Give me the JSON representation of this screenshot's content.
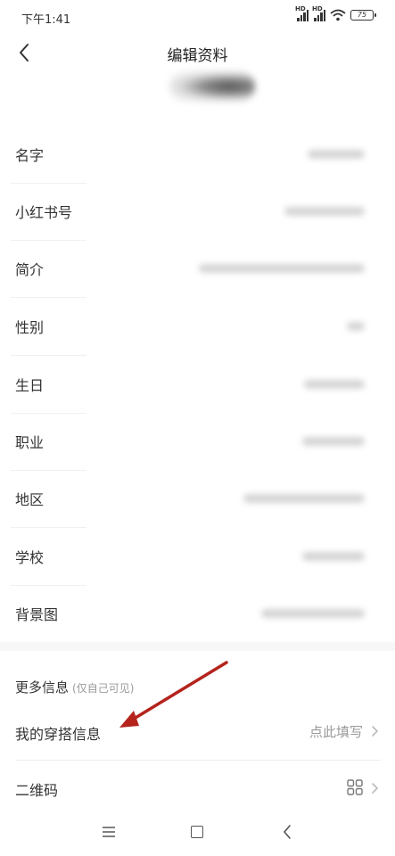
{
  "status_bar": {
    "time": "下午1:41",
    "signal_1": "HD",
    "signal_2": "HD",
    "battery": "75"
  },
  "header": {
    "back_icon": "chevron-left-icon",
    "title": "编辑资料"
  },
  "fields": [
    {
      "label": "名字"
    },
    {
      "label": "小红书号"
    },
    {
      "label": "简介"
    },
    {
      "label": "性别"
    },
    {
      "label": "生日"
    },
    {
      "label": "职业"
    },
    {
      "label": "地区"
    },
    {
      "label": "学校"
    },
    {
      "label": "背景图"
    }
  ],
  "more_info": {
    "title": "更多信息",
    "hint": "(仅自己可见)"
  },
  "outfit": {
    "label": "我的穿搭信息",
    "value": "点此填写"
  },
  "qr": {
    "label": "二维码",
    "icon": "qr-grid-icon"
  },
  "colors": {
    "annotation": "#b5231d",
    "text": "#333333",
    "muted": "#999999"
  },
  "nav": {
    "menu_icon": "menu-icon",
    "home_icon": "home-square-icon",
    "back_icon": "back-triangle-icon"
  }
}
